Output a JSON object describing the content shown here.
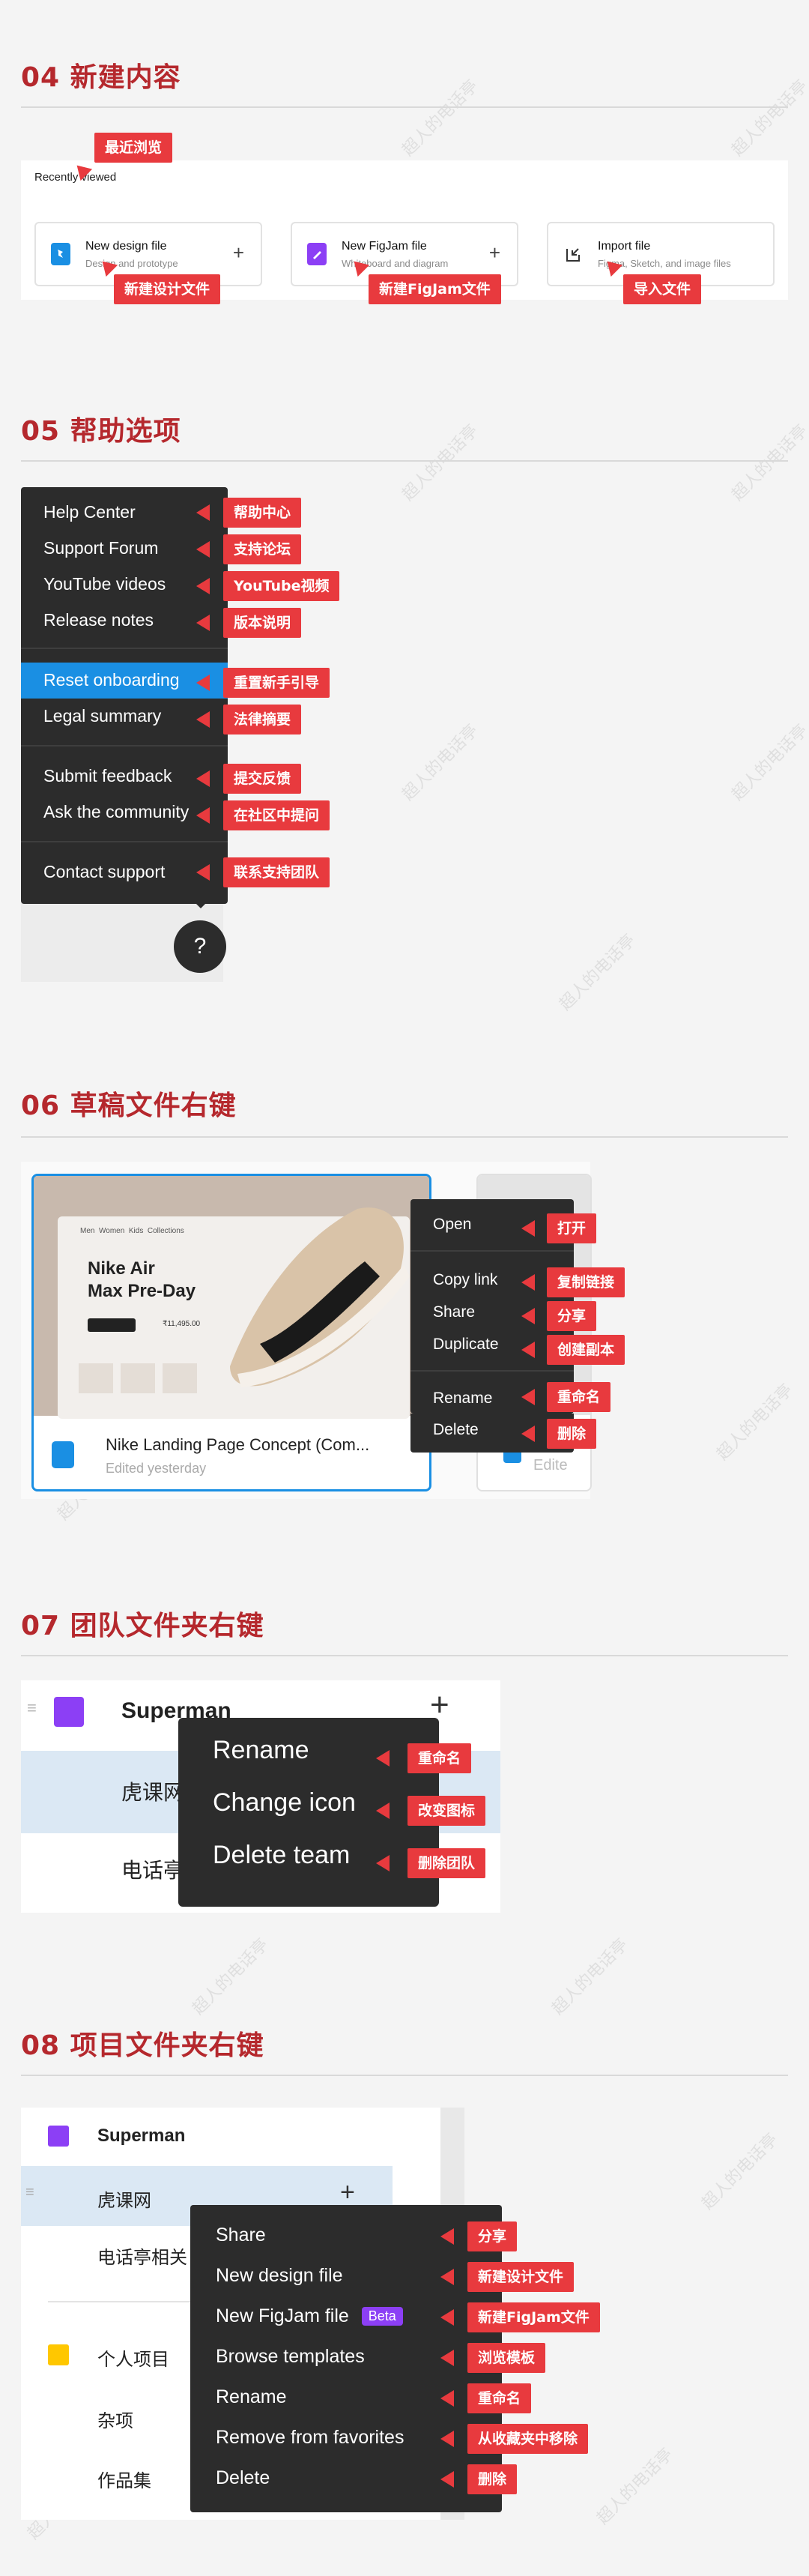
{
  "watermark": "超人的电话亭",
  "sec04": {
    "title": "04 新建内容",
    "recently_viewed": "Recently viewed",
    "callouts": {
      "recent": "最近浏览",
      "new_design": "新建设计文件",
      "new_figjam": "新建FigJam文件",
      "import": "导入文件"
    },
    "cards": [
      {
        "title": "New design file",
        "subtitle": "Design and prototype",
        "icon": "design-file-icon"
      },
      {
        "title": "New FigJam file",
        "subtitle": "Whiteboard and diagram",
        "icon": "figjam-file-icon"
      },
      {
        "title": "Import file",
        "subtitle": "Figma, Sketch, and image files",
        "icon": "import-icon"
      }
    ]
  },
  "sec05": {
    "title": "05 帮助选项",
    "items": [
      {
        "label": "Help Center",
        "cn": "帮助中心"
      },
      {
        "label": "Support Forum",
        "cn": "支持论坛"
      },
      {
        "label": "YouTube videos",
        "cn": "YouTube视频"
      },
      {
        "label": "Release notes",
        "cn": "版本说明"
      },
      {
        "label": "Reset onboarding",
        "cn": "重置新手引导"
      },
      {
        "label": "Legal summary",
        "cn": "法律摘要"
      },
      {
        "label": "Submit feedback",
        "cn": "提交反馈"
      },
      {
        "label": "Ask the community",
        "cn": "在社区中提问"
      },
      {
        "label": "Contact support",
        "cn": "联系支持团队"
      }
    ],
    "help_button": "?"
  },
  "sec06": {
    "title": "06 草稿文件右键",
    "file_name": "Nike Landing Page Concept (Com...",
    "file_edited": "Edited yesterday",
    "side_edited": "Edite",
    "thumb": {
      "heading_line1": "Nike Air",
      "heading_line2": "Max Pre-Day",
      "price": "₹11,495.00",
      "nav": [
        "Men",
        "Women",
        "Kids",
        "Collections"
      ]
    },
    "items": [
      {
        "label": "Open",
        "cn": "打开"
      },
      {
        "label": "Copy link",
        "cn": "复制链接"
      },
      {
        "label": "Share",
        "cn": "分享"
      },
      {
        "label": "Duplicate",
        "cn": "创建副本"
      },
      {
        "label": "Rename",
        "cn": "重命名"
      },
      {
        "label": "Delete",
        "cn": "删除"
      }
    ]
  },
  "sec07": {
    "title": "07 团队文件夹右键",
    "team_name": "Superman",
    "row1": "虎课网",
    "row2": "电话亭",
    "items": [
      {
        "label": "Rename",
        "cn": "重命名"
      },
      {
        "label": "Change icon",
        "cn": "改变图标"
      },
      {
        "label": "Delete team",
        "cn": "删除团队"
      }
    ]
  },
  "sec08": {
    "title": "08 项目文件夹右键",
    "team_name": "Superman",
    "row1": "虎课网",
    "row2": "电话亭相关",
    "personal": "个人项目",
    "misc": "杂项",
    "portfolio": "作品集",
    "beta": "Beta",
    "items": [
      {
        "label": "Share",
        "cn": "分享"
      },
      {
        "label": "New design file",
        "cn": "新建设计文件"
      },
      {
        "label": "New FigJam file",
        "cn": "新建FigJam文件"
      },
      {
        "label": "Browse templates",
        "cn": "浏览模板"
      },
      {
        "label": "Rename",
        "cn": "重命名"
      },
      {
        "label": "Remove from favorites",
        "cn": "从收藏夹中移除"
      },
      {
        "label": "Delete",
        "cn": "删除"
      }
    ]
  },
  "colors": {
    "accent_red": "#b5282d",
    "callout_red": "#e83a3e",
    "menu_bg": "#2c2c2c",
    "highlight_blue": "#1a8fe3",
    "purple": "#8c3ff5",
    "yellow": "#ffc700"
  }
}
